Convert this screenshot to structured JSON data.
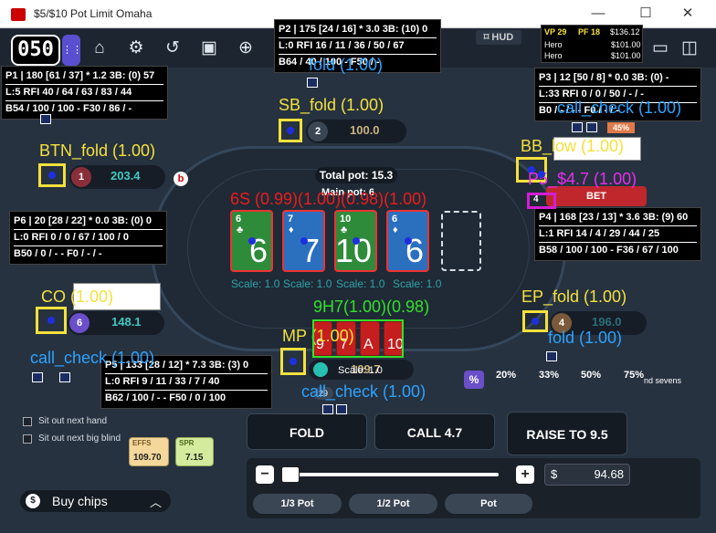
{
  "window": {
    "title": "$5/$10 Pot Limit Omaha",
    "minimize": "—",
    "maximize": "☐",
    "close": "✕"
  },
  "toolbar": {
    "table_count": "050",
    "hud_label": "HUD"
  },
  "session": {
    "vp": "VP 29",
    "pf": "PF 18",
    "total": "$136.12",
    "rows": [
      {
        "name": "Hero",
        "val": "$101.00"
      },
      {
        "name": "Hero",
        "val": "$101.00"
      }
    ]
  },
  "huds": {
    "p1": {
      "r1": "P1 | 180 [61 / 37] * 1.2 3B: (0) 57",
      "r2": "L:5 RFI 40 / 64 / 63 / 83 / 44",
      "r3": "B54 / 100 / 100 - F30 / 86 / -"
    },
    "p2": {
      "r1": "P2 | 175 [24 / 16] * 3.0 3B: (10) 0",
      "r2": "L:0 RFI 16 / 11 / 36 / 50 / 67",
      "r3": "B64 / 40 / 100 - F50 / -"
    },
    "p3": {
      "r1": "P3 | 12 [50 / 8] * 0.0 3B: (0) -",
      "r2": "L:33 RFI 0 / 0 / 50 / - / -",
      "r3": "B0 / - / - - F0 / - / -"
    },
    "p4": {
      "r1": "P4 | 168 [23 / 13] * 3.6 3B: (9) 60",
      "r2": "L:1 RFI 14 / 4 / 29 / 44 / 25",
      "r3": "B58 / 100 / 100 - F36 / 67 / 100"
    },
    "p5": {
      "r1": "P5 | 133 [28 / 12] * 7.3 3B: (3) 0",
      "r2": "L:0 RFI 9 / 11 / 33 / 7 / 40",
      "r3": "B62 / 100 / - - F50 / 0 / 100"
    },
    "p6": {
      "r1": "P6 | 20 [28 / 22] * 0.0 3B: (0) 0",
      "r2": "L:0 RFI 0 / 0 / 67 / 100 / 0",
      "r3": "B50 / 0 / - - F0 / - / -"
    }
  },
  "seats": {
    "sb": {
      "pos": "2",
      "stack": "100.0"
    },
    "btn": {
      "pos": "1",
      "stack": "203.4"
    },
    "co": {
      "pos": "6",
      "stack": "148.1"
    },
    "ep": {
      "pos": "4",
      "stack": "196.0"
    },
    "bb_pct": "45%"
  },
  "board": {
    "total_pot": "Total pot: 15.3",
    "main_pot": "Main pot: 6",
    "cards": [
      {
        "rank": "6",
        "suit": "♣",
        "color": "#2e8b3a"
      },
      {
        "rank": "7",
        "suit": "♦",
        "color": "#2b6fbf"
      },
      {
        "rank": "10",
        "suit": "♣",
        "color": "#2e8b3a"
      },
      {
        "rank": "6",
        "suit": "♦",
        "color": "#2b6fbf"
      }
    ],
    "scale_text": "Scale: 1.0"
  },
  "hero": {
    "cards": [
      "9",
      "7",
      "A",
      "10"
    ],
    "stack": "109.7",
    "bet_chip": "29"
  },
  "bb_bet_label": "BET",
  "bb_bet_chip": "4",
  "sizing_pcts": [
    "20%",
    "33%",
    "50%",
    "75%"
  ],
  "sevens_label": "nd sevens",
  "percent_symbol": "%",
  "effs": {
    "label": "EFFS",
    "value": "109.70"
  },
  "spr": {
    "label": "SPR",
    "value": "7.15"
  },
  "sitout": {
    "next_hand": "Sit out next hand",
    "next_bb": "Sit out next big blind"
  },
  "buy_chips": "Buy chips",
  "actions": {
    "fold": "FOLD",
    "call": "CALL 4.7",
    "raise": "RAISE TO 9.5"
  },
  "bet_input": {
    "currency": "$",
    "value": "94.68"
  },
  "pot_buttons": [
    "1/3 Pot",
    "1/2 Pot",
    "Pot"
  ],
  "overlays": {
    "sb": "SB_fold (1.00)",
    "btn": "BTN_fold (1.00)",
    "bb": "BB_low (1.00)",
    "co": "CO (1.00)",
    "ep": "EP_fold (1.00)",
    "mp": "MP (1.00)",
    "fold_top": "fold (1.00)",
    "fold_right": "fold (1.00)",
    "call_top": "call_check (1.00)",
    "call_left": "call_check (1.00)",
    "call_bottom": "call_check (1.00)",
    "p5_bet": "P5_$4.7 (1.00)",
    "board_red": "6S (0.99)(1.00)(0.98)(1.00)",
    "hole_green": "9H7(1.00)(0.98)",
    "scale_bottom": "Scale: 1.0"
  }
}
